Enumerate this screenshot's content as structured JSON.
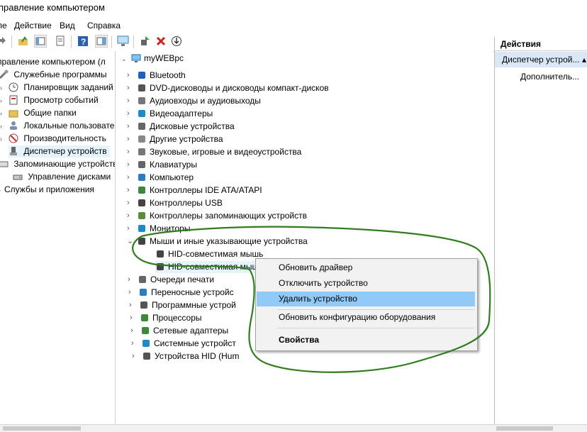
{
  "window": {
    "title": "правление компьютером"
  },
  "menu": [
    "ле",
    "Действие",
    "Вид",
    "Справка"
  ],
  "left_tree": [
    {
      "label": "правление компьютером (л",
      "indent": 0
    },
    {
      "label": "Служебные программы",
      "indent": 1
    },
    {
      "label": "Планировщик заданий",
      "indent": 2
    },
    {
      "label": "Просмотр событий",
      "indent": 2
    },
    {
      "label": "Общие папки",
      "indent": 2
    },
    {
      "label": "Локальные пользовате",
      "indent": 2
    },
    {
      "label": "Производительность",
      "indent": 2
    },
    {
      "label": "Диспетчер устройств",
      "indent": 2
    },
    {
      "label": "Запоминающие устройств",
      "indent": 1
    },
    {
      "label": "Управление дисками",
      "indent": 2
    },
    {
      "label": "Службы и приложения",
      "indent": 1
    }
  ],
  "device_tree": {
    "root": "myWEBpc",
    "categories": [
      "Bluetooth",
      "DVD-дисководы и дисководы компакт-дисков",
      "Аудиовходы и аудиовыходы",
      "Видеоадаптеры",
      "Дисковые устройства",
      "Другие устройства",
      "Звуковые, игровые и видеоустройства",
      "Клавиатуры",
      "Компьютер",
      "Контроллеры IDE ATA/ATAPI",
      "Контроллеры USB",
      "Контроллеры запоминающих устройств",
      "Мониторы",
      "Мыши и иные указывающие устройства",
      "HID-совместимая мышь",
      "HID-совместимая мышь",
      "Очереди печати",
      "Переносные устройс",
      "Программные устрой",
      "Процессоры",
      "Сетевые адаптеры",
      "Системные устройст",
      "Устройства HID (Hum"
    ]
  },
  "context_menu": {
    "items": [
      "Обновить драйвер",
      "Отключить устройство",
      "Удалить устройство",
      "Обновить конфигурацию оборудования",
      "Свойства"
    ]
  },
  "actions_pane": {
    "header": "Действия",
    "selected": "Диспетчер устрой...",
    "more": "Дополнитель..."
  }
}
